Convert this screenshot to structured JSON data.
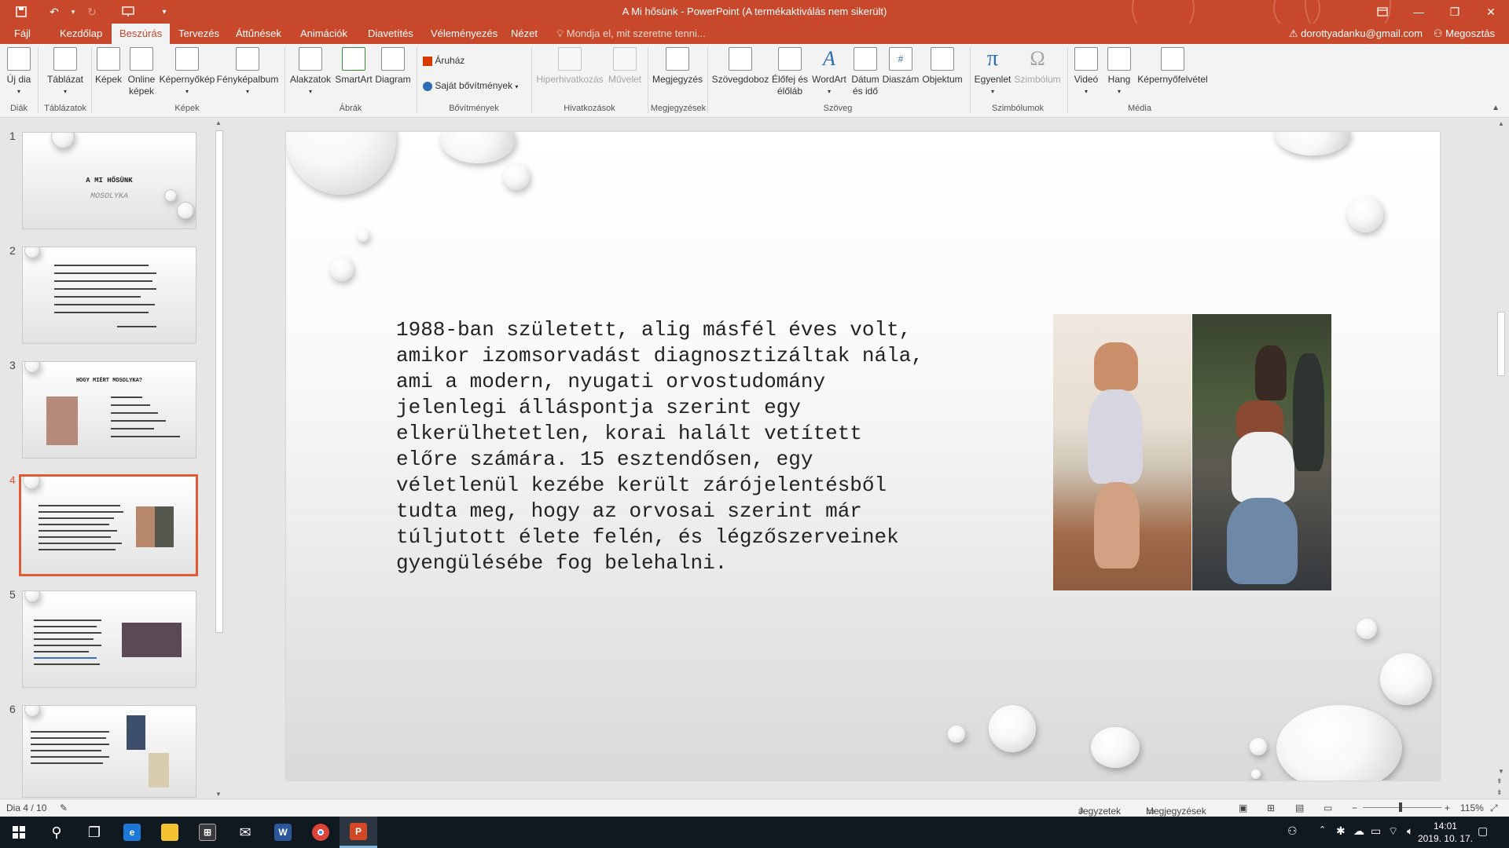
{
  "window": {
    "title": "A Mi hősünk - PowerPoint (A termékaktiválás nem sikerült)",
    "accent_color": "#c8482b"
  },
  "quick_access": [
    "save-icon",
    "undo-icon",
    "redo-icon",
    "present-icon",
    "customize-icon"
  ],
  "tabs": [
    {
      "label": "Fájl"
    },
    {
      "label": "Kezdőlap"
    },
    {
      "label": "Beszúrás"
    },
    {
      "label": "Tervezés"
    },
    {
      "label": "Áttűnések"
    },
    {
      "label": "Animációk"
    },
    {
      "label": "Diavetítés"
    },
    {
      "label": "Véleményezés"
    },
    {
      "label": "Nézet"
    }
  ],
  "active_tab": "Beszúrás",
  "tell_me": "Mondja el, mit szeretne tenni...",
  "account": "dorottyadanku@gmail.com",
  "share": "Megosztás",
  "ribbon": {
    "buttons": {
      "new_slide": "Új dia",
      "table": "Táblázat",
      "pictures": "Képek",
      "online_pictures_1": "Online",
      "online_pictures_2": "képek",
      "screenshot": "Képernyőkép",
      "photo_album": "Fényképalbum",
      "shapes": "Alakzatok",
      "smartart": "SmartArt",
      "chart": "Diagram",
      "store": "Áruház",
      "my_addins": "Saját bővítmények",
      "hyperlink": "Hiperhivatkozás",
      "action": "Művelet",
      "comment": "Megjegyzés",
      "textbox": "Szövegdoboz",
      "header_footer_1": "Élőfej és",
      "header_footer_2": "élőláb",
      "wordart": "WordArt",
      "datetime_1": "Dátum",
      "datetime_2": "és idő",
      "slide_number": "Diaszám",
      "object": "Objektum",
      "equation": "Egyenlet",
      "symbol": "Szimbólum",
      "video": "Videó",
      "audio": "Hang",
      "screen_recording": "Képernyőfelvétel"
    },
    "groups": {
      "slides": "Diák",
      "tables": "Táblázatok",
      "images": "Képek",
      "illustrations": "Ábrák",
      "addins": "Bővítmények",
      "links": "Hivatkozások",
      "comments": "Megjegyzések",
      "text": "Szöveg",
      "symbols": "Szimbólumok",
      "media": "Média"
    }
  },
  "thumbnails": [
    {
      "num": "1",
      "title": "A MI HŐSÜNK",
      "subtitle": "MOSOLYKA"
    },
    {
      "num": "2"
    },
    {
      "num": "3",
      "title": "HOGY MIÉRT MOSOLYKA?"
    },
    {
      "num": "4"
    },
    {
      "num": "5"
    },
    {
      "num": "6"
    }
  ],
  "selected_slide": 4,
  "slide": {
    "body_text": "1988-ban született, alig másfél éves volt,\namikor izomsorvadást diagnosztizáltak nála,\nami a modern, nyugati orvostudomány\njelenlegi álláspontja szerint egy\nelkerülhetetlen, korai halált vetített\nelőre számára. 15 esztendősen, egy\nvéletlenül kezébe került zárójelentésből\ntudta meg, hogy az orvosai szerint már\ntúljutott élete felén, és légzőszerveinek\ngyengülésébe fog belehalni."
  },
  "status": {
    "slide_counter": "Dia 4 / 10",
    "notes": "Jegyzetek",
    "comments": "Megjegyzések",
    "zoom": "115%"
  },
  "taskbar": {
    "apps": [
      "start-icon",
      "search-icon",
      "task-view-icon",
      "edge-icon",
      "explorer-icon",
      "store-icon",
      "mail-icon",
      "word-icon",
      "chrome-icon",
      "powerpoint-icon"
    ],
    "time": "14:01",
    "date": "2019. 10. 17."
  }
}
